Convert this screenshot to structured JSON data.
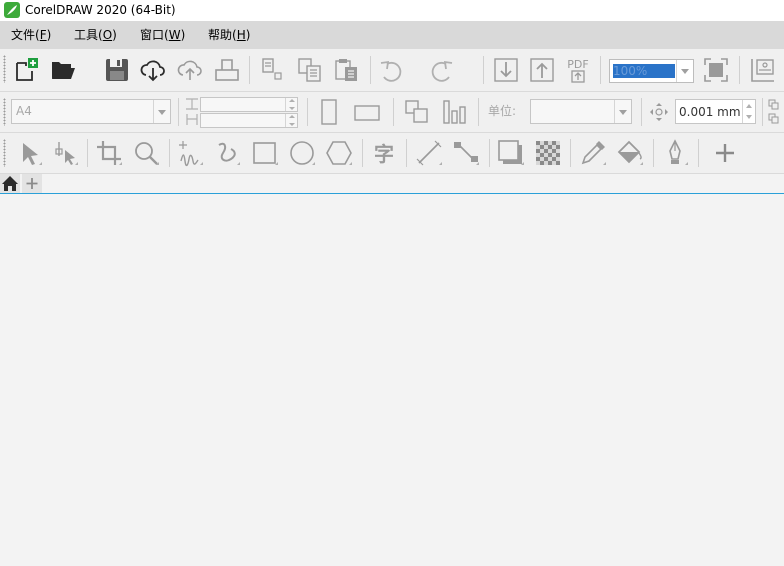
{
  "window": {
    "title": "CorelDRAW 2020 (64-Bit)"
  },
  "menu": [
    {
      "label": "文件(F)",
      "text": "文件(",
      "key": "F",
      "close": ")"
    },
    {
      "label": "工具(O)",
      "text": "工具(",
      "key": "O",
      "close": ")"
    },
    {
      "label": "窗口(W)",
      "text": "窗口(",
      "key": "W",
      "close": ")"
    },
    {
      "label": "帮助(H)",
      "text": "帮助(",
      "key": "H",
      "close": ")"
    }
  ],
  "standard_toolbar": {
    "icons": [
      "new-document-icon",
      "open-folder-icon",
      "save-icon",
      "cloud-download-icon",
      "cloud-upload-icon",
      "print-icon",
      "cut-icon",
      "copy-icon",
      "paste-icon",
      "undo-icon",
      "redo-icon",
      "import-icon",
      "export-icon",
      "publish-pdf-icon",
      "full-screen-icon",
      "rulers-icon"
    ],
    "pdf_label": "PDF",
    "zoom_level": "100%"
  },
  "property_bar": {
    "page_size": "A4",
    "units_label": "单位:",
    "units_value": "",
    "nudge_distance": "0.001 mm"
  },
  "toolbox": {
    "text_tool_glyph": "字",
    "icons": [
      "pick-tool-icon",
      "shape-tool-icon",
      "crop-tool-icon",
      "zoom-tool-icon",
      "freehand-tool-icon",
      "artistic-media-icon",
      "rectangle-tool-icon",
      "ellipse-tool-icon",
      "polygon-tool-icon",
      "text-tool-icon",
      "parallel-dimension-icon",
      "connector-tool-icon",
      "drop-shadow-icon",
      "transparency-icon",
      "eyedropper-icon",
      "interactive-fill-icon",
      "smart-fill-icon",
      "add-tool-icon"
    ]
  },
  "colors": {
    "title_bg": "#ffffff",
    "menu_bg": "#d9d9d9",
    "toolbar_bg": "#f0f0f0",
    "workspace_bg": "#f3f3f3",
    "accent_line": "#2aa0d8",
    "logo_green": "#3daa3a",
    "zoom_highlight": "#2a73c8"
  }
}
